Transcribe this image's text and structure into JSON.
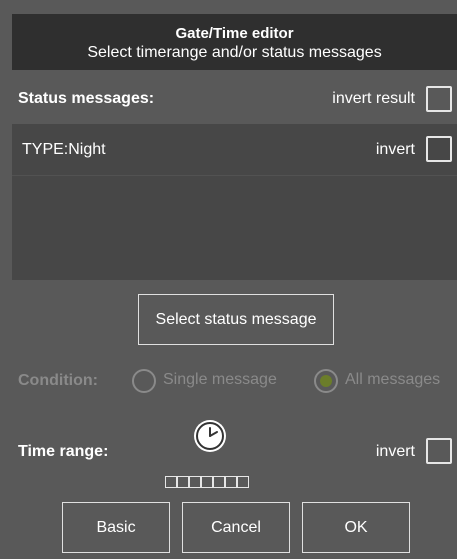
{
  "dialog": {
    "title": "Gate/Time editor",
    "subtitle": "Select timerange and/or status messages"
  },
  "status": {
    "label": "Status messages:",
    "invert_result_label": "invert result",
    "invert_result_checked": false,
    "items": [
      {
        "text": "TYPE:Night",
        "invert_label": "invert",
        "invert_checked": false
      }
    ],
    "select_button": "Select status message"
  },
  "condition": {
    "label": "Condition:",
    "options": [
      {
        "label": "Single message",
        "selected": false
      },
      {
        "label": "All messages",
        "selected": true
      }
    ],
    "enabled": false
  },
  "time_range": {
    "label": "Time range:",
    "invert_label": "invert",
    "invert_checked": false,
    "icon": "clock-icon"
  },
  "buttons": {
    "basic": "Basic",
    "cancel": "Cancel",
    "ok": "OK"
  },
  "colors": {
    "background": "#595959",
    "header": "#2f2f2f",
    "list": "#474747",
    "disabled_text": "#8a8a8a",
    "radio_selected": "#6b7d2a"
  }
}
